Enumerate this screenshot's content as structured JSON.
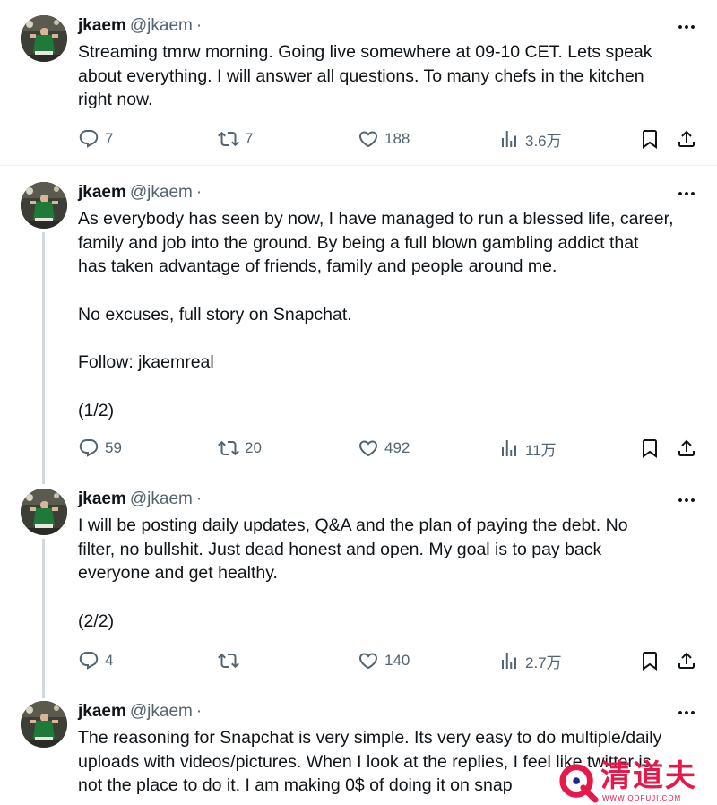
{
  "tweets": [
    {
      "name": "jkaem",
      "handle": "@jkaem",
      "sep": "·",
      "text": "Streaming tmrw morning. Going live somewhere at 09-10 CET. Lets speak\nabout everything. I will answer all questions. To many chefs in the kitchen\nright now.",
      "replies": "7",
      "reposts": "7",
      "likes": "188",
      "views": "3.6万"
    },
    {
      "name": "jkaem",
      "handle": "@jkaem",
      "sep": "·",
      "text": "As everybody has seen by now, I have managed to run a blessed life, career,\nfamily and job into the ground. By being a full blown gambling addict that\nhas taken advantage of friends, family and people around me.\n\nNo excuses, full story on Snapchat.\n\nFollow: jkaemreal\n\n(1/2)",
      "replies": "59",
      "reposts": "20",
      "likes": "492",
      "views": "11万"
    },
    {
      "name": "jkaem",
      "handle": "@jkaem",
      "sep": "·",
      "text": "I will be posting daily updates, Q&A and the plan of paying the debt. No\nfilter, no bullshit. Just dead honest and open. My goal is to pay back\neveryone and get healthy.\n\n(2/2)",
      "replies": "4",
      "reposts": "",
      "likes": "140",
      "views": "2.7万"
    },
    {
      "name": "jkaem",
      "handle": "@jkaem",
      "sep": "·",
      "text": "The reasoning for Snapchat is very simple. Its very easy to do multiple/daily\nuploads with videos/pictures. When I look at the replies, I feel like twitter is\nnot the place to do it. I am making 0$ of doing it on snap"
    }
  ],
  "watermark": {
    "text": "清道夫",
    "sub": "WWW.QDFUJI.COM"
  },
  "colors": {
    "text": "#0f1419",
    "secondary": "#536471",
    "thread": "#cfd9de",
    "watermark": "#e6194b"
  },
  "icons": [
    "reply-icon",
    "repost-icon",
    "like-icon",
    "views-icon",
    "bookmark-icon",
    "share-icon",
    "more-icon"
  ]
}
